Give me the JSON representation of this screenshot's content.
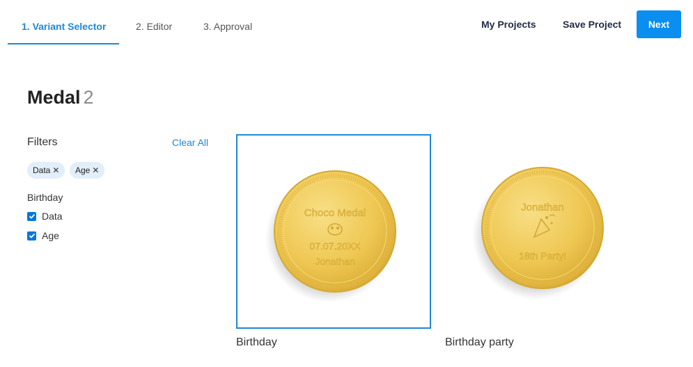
{
  "tabs": [
    {
      "label": "1. Variant Selector",
      "active": true
    },
    {
      "label": "2. Editor",
      "active": false
    },
    {
      "label": "3. Approval",
      "active": false
    }
  ],
  "header": {
    "my_projects": "My Projects",
    "save_project": "Save Project",
    "next": "Next"
  },
  "page": {
    "title": "Medal",
    "count": "2"
  },
  "filters": {
    "heading": "Filters",
    "clear_all": "Clear All",
    "chips": [
      {
        "label": "Data",
        "remove": "✕"
      },
      {
        "label": "Age",
        "remove": "✕"
      }
    ],
    "group": "Birthday",
    "options": [
      {
        "label": "Data",
        "checked": true
      },
      {
        "label": "Age",
        "checked": true
      }
    ]
  },
  "products": [
    {
      "label": "Birthday",
      "selected": true,
      "lines": [
        "Choco Medal",
        "07.07.20XX",
        "Jonathan"
      ],
      "icon": "mask-icon"
    },
    {
      "label": "Birthday party",
      "selected": false,
      "lines": [
        "Jonathan",
        "18th Party!"
      ],
      "icon": "party-popper-icon"
    }
  ],
  "colors": {
    "accent": "#1e88d6",
    "button": "#0a8ef0",
    "gold": "#f0cc5a"
  }
}
